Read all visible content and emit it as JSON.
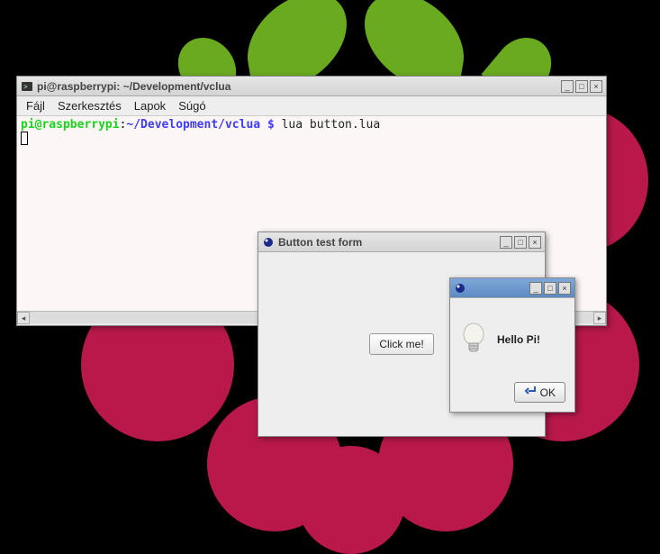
{
  "terminal": {
    "title": "pi@raspberrypi: ~/Development/vclua",
    "menu": {
      "file": "Fájl",
      "edit": "Szerkesztés",
      "tabs": "Lapok",
      "help": "Súgó"
    },
    "prompt": {
      "userhost": "pi@raspberrypi",
      "colon": ":",
      "path": "~/Development/vclua",
      "dollar": " $ ",
      "command": "lua button.lua"
    }
  },
  "form": {
    "title": "Button test form",
    "button_label": "Click me!"
  },
  "dialog": {
    "title": "",
    "message": "Hello Pi!",
    "ok_label": "OK"
  },
  "window_controls": {
    "minimize": "_",
    "maximize": "□",
    "close": "×"
  }
}
